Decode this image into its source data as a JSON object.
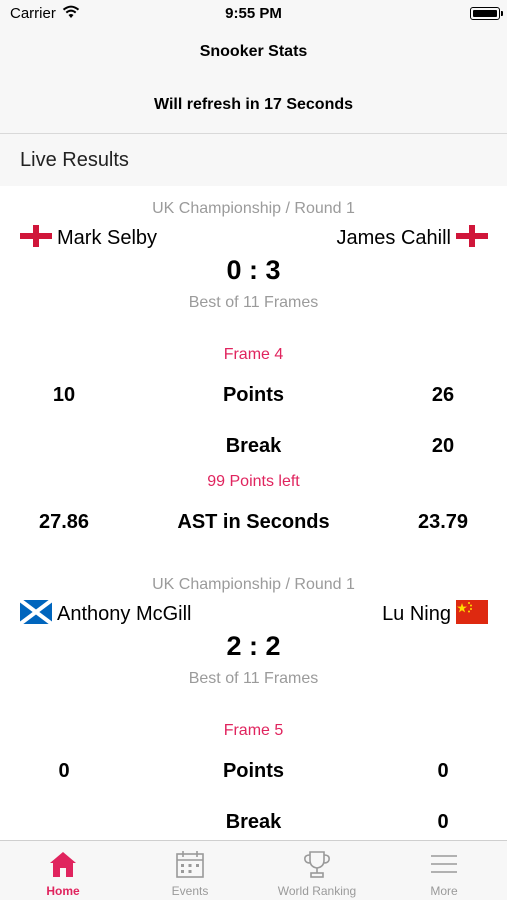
{
  "status_bar": {
    "carrier": "Carrier",
    "time": "9:55 PM"
  },
  "nav": {
    "title": "Snooker Stats",
    "refresh": "Will refresh in 17 Seconds"
  },
  "section": {
    "title": "Live Results"
  },
  "matches": [
    {
      "event": "UK Championship / Round 1",
      "player1": {
        "name": "Mark Selby",
        "flag": "england-flag-icon"
      },
      "player2": {
        "name": "James Cahill",
        "flag": "england-flag-icon"
      },
      "score": "0 : 3",
      "best_of": "Best of 11 Frames",
      "frame": "Frame 4",
      "points": {
        "label": "Points",
        "p1": "10",
        "p2": "26"
      },
      "break": {
        "label": "Break",
        "p1": "",
        "p2": "20"
      },
      "points_left": "99 Points left",
      "ast": {
        "label": "AST in Seconds",
        "p1": "27.86",
        "p2": "23.79"
      }
    },
    {
      "event": "UK Championship / Round 1",
      "player1": {
        "name": "Anthony McGill",
        "flag": "scotland-flag-icon"
      },
      "player2": {
        "name": "Lu Ning",
        "flag": "china-flag-icon"
      },
      "score": "2 : 2",
      "best_of": "Best of 11 Frames",
      "frame": "Frame 5",
      "points": {
        "label": "Points",
        "p1": "0",
        "p2": "0"
      },
      "break": {
        "label": "Break",
        "p1": "",
        "p2": "0"
      }
    }
  ],
  "tabs": [
    {
      "label": "Home",
      "icon": "home-icon",
      "active": true
    },
    {
      "label": "Events",
      "icon": "calendar-icon",
      "active": false
    },
    {
      "label": "World Ranking",
      "icon": "trophy-icon",
      "active": false
    },
    {
      "label": "More",
      "icon": "menu-icon",
      "active": false
    }
  ],
  "colors": {
    "accent": "#e0245e",
    "secondary_text": "#9b9b9b",
    "bar_background": "#f7f7f7",
    "england_red": "#d0163a",
    "scotland_blue": "#0065bd",
    "china_red": "#de2910",
    "china_yellow": "#ffde00"
  }
}
